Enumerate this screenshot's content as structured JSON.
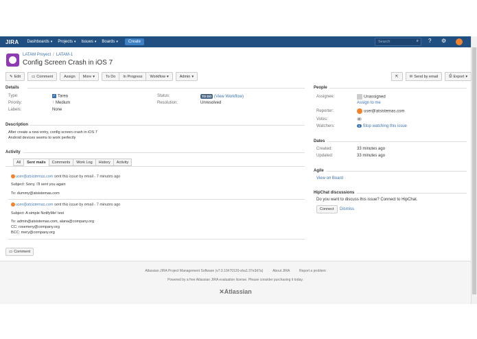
{
  "topnav": {
    "logo": "JIRA",
    "items": [
      "Dashboards",
      "Projects",
      "Issues",
      "Boards"
    ],
    "create": "Create",
    "search_placeholder": "Search"
  },
  "breadcrumb": {
    "project": "LATAM Proyect",
    "issue_key": "LATAM-1"
  },
  "issue": {
    "title": "Config Screen Crash in iOS 7"
  },
  "toolbar": {
    "edit": "Edit",
    "comment": "Comment",
    "assign": "Assign",
    "more": "More",
    "todo": "To Do",
    "in_progress": "In Progress",
    "workflow": "Workflow",
    "admin": "Admin",
    "send_email": "Send by email",
    "export": "Export"
  },
  "details": {
    "heading": "Details",
    "type_label": "Type:",
    "type_value": "Tarea",
    "priority_label": "Priority:",
    "priority_value": "Medium",
    "labels_label": "Labels:",
    "labels_value": "None",
    "status_label": "Status:",
    "status_value": "TO DO",
    "status_link": "(View Workflow)",
    "resolution_label": "Resolution:",
    "resolution_value": "Unresolved"
  },
  "description": {
    "heading": "Description",
    "line1": "After create a new entry, config screen crash in iOS 7",
    "line2": "Android devices seems to work perfectly"
  },
  "activity": {
    "heading": "Activity",
    "tabs": [
      "All",
      "Sent mails",
      "Comments",
      "Work Log",
      "History",
      "Activity"
    ],
    "mails": [
      {
        "sender": "user@atsistemas.com",
        "meta": "sent this issue by email - 7 minutes ago",
        "subject": "Subject: Sorry, I'll sent you again",
        "to": "To: dummy@atsistemas.com"
      },
      {
        "sender": "user@atsistemas.com",
        "meta": "sent this issue by email - 7 minutes ago",
        "subject": "Subject: A simple NotifyMe! test",
        "to": "To: admin@atsistemas.com, alana@company.org",
        "cc": "CC: rosemery@company.org",
        "bcc": "BCC: mery@company.org"
      }
    ],
    "comment_button": "Comment"
  },
  "people": {
    "heading": "People",
    "assignee_label": "Assignee:",
    "assignee_value": "Unassigned",
    "assign_me": "Assign to me",
    "reporter_label": "Reporter:",
    "reporter_value": "user@atsistemas.com",
    "votes_label": "Votes:",
    "votes_value": "0",
    "watchers_label": "Watchers:",
    "watchers_count": "1",
    "watchers_link": "Stop watching this issue"
  },
  "dates": {
    "heading": "Dates",
    "created_label": "Created:",
    "created_value": "33 minutes ago",
    "updated_label": "Updated:",
    "updated_value": "33 minutes ago"
  },
  "agile": {
    "heading": "Agile",
    "link": "View on Board"
  },
  "hipchat": {
    "heading": "HipChat discussions",
    "text": "Do you want to discuss this issue? Connect to HipChat.",
    "connect": "Connect",
    "dismiss": "Dismiss"
  },
  "footer": {
    "software": "Atlassian JIRA Project Management Software (v7.0.10#70120-sha1:37e3d7a)",
    "about": "About JIRA",
    "report": "Report a problem",
    "powered": "Powered by a free Atlassian JIRA evaluation license. Please consider purchasing it today.",
    "logo": "Atlassian"
  },
  "colors": {
    "nav": "#205081",
    "link": "#3b73af",
    "create": "#3b7fc4",
    "status": "#4a6785"
  }
}
